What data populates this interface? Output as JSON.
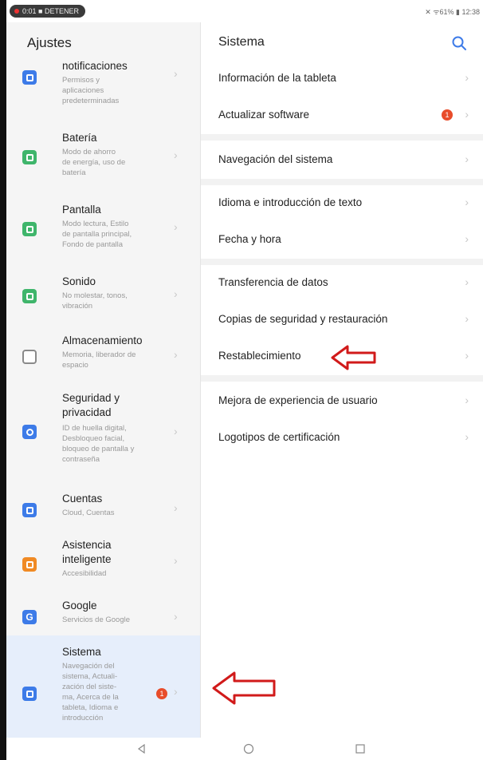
{
  "status_bar": {
    "recording": "0:01 ■ DETENER",
    "right": "✕ ᯤ61% ▮ 12:38"
  },
  "left_pane": {
    "title": "Ajustes",
    "items": [
      {
        "title": "notificaciones",
        "subtitle": [
          "Permisos y",
          "aplicaciones",
          "predeterminadas"
        ],
        "icon": "notifications-icon",
        "color": "#3d7be8"
      },
      {
        "title": "Batería",
        "subtitle": [
          "Modo de ahorro",
          "de energía, uso de",
          "batería"
        ],
        "icon": "battery-icon",
        "color": "#3fb56b"
      },
      {
        "title": "Pantalla",
        "subtitle": [
          "Modo lectura, Estilo",
          "de pantalla principal,",
          "Fondo de pantalla"
        ],
        "icon": "display-icon",
        "color": "#3fb56b"
      },
      {
        "title": "Sonido",
        "subtitle": [
          "No molestar, tonos,",
          "vibración"
        ],
        "icon": "sound-icon",
        "color": "#3fb56b"
      },
      {
        "title": "Almacenamiento",
        "subtitle": [
          "Memoria, liberador de",
          "espacio"
        ],
        "icon": "storage-icon",
        "color": "#9a9a9a"
      },
      {
        "title": "Seguridad y privacidad",
        "subtitle": [
          "ID de huella digital,",
          "Desbloqueo facial,",
          "bloqueo de pantalla y",
          "contraseña"
        ],
        "icon": "security-icon",
        "color": "#3d7be8"
      },
      {
        "title": "Cuentas",
        "subtitle": [
          "Cloud, Cuentas"
        ],
        "icon": "accounts-icon",
        "color": "#3d7be8"
      },
      {
        "title": "Asistencia inteligente",
        "subtitle": [
          "Accesibilidad"
        ],
        "icon": "assistance-icon",
        "color": "#f08a24"
      },
      {
        "title": "Google",
        "subtitle": [
          "Servicios de Google"
        ],
        "icon": "google-icon",
        "color": "#3d7be8"
      },
      {
        "title": "Sistema",
        "subtitle": [
          "Navegación del",
          "sistema, Actuali-",
          "zación del siste-",
          "ma, Acerca de la",
          "tableta, Idioma e",
          "introducción"
        ],
        "icon": "system-icon",
        "color": "#3d7be8",
        "badge": "1"
      }
    ]
  },
  "right_pane": {
    "title": "Sistema",
    "items": [
      {
        "label": "Información de la tableta"
      },
      {
        "label": "Actualizar software",
        "badge": "1"
      },
      {
        "label": "Navegación del sistema"
      },
      {
        "label": "Idioma e introducción de texto"
      },
      {
        "label": "Fecha y hora"
      },
      {
        "label": "Transferencia de datos"
      },
      {
        "label": "Copias de seguridad y restauración"
      },
      {
        "label": "Restablecimiento"
      },
      {
        "label": "Mejora de experiencia de usuario"
      },
      {
        "label": "Logotipos de certificación"
      }
    ]
  },
  "colors": {
    "accent": "#3d7be8",
    "badge": "#e84c2a",
    "annotation_arrow": "#d11a1a",
    "selected_bg": "#e6eefb"
  }
}
